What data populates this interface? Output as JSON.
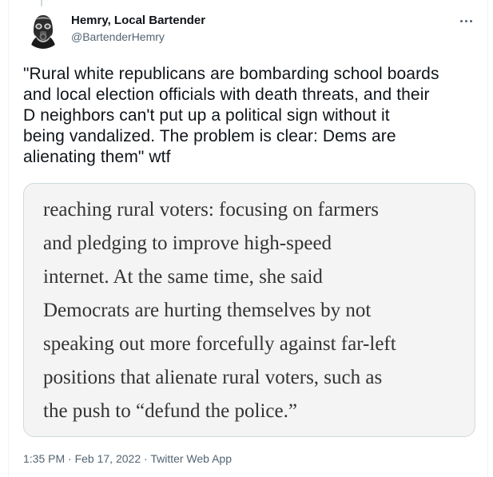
{
  "tweet": {
    "author": {
      "display_name": "Hemry, Local Bartender",
      "handle": "@BartenderHemry"
    },
    "text": "\"Rural white republicans are bombarding school boards\nand local election officials with death threats, and their\nD neighbors can't put up a political sign without it\nbeing vandalized. The problem is clear: Dems are\nalienating them\" wtf",
    "media": {
      "cut_text": "",
      "body": "reaching rural voters: focusing on farmers\nand pledging to improve high-speed\ninternet. At the same time, she said\nDemocrats are hurting themselves by not\nspeaking out more forcefully against far-left\npositions that alienate rural voters, such as\nthe push to “defund the police.”"
    },
    "meta": {
      "time": "1:35 PM",
      "separator": "·",
      "date": "Feb 17, 2022",
      "source": "Twitter Web App"
    }
  },
  "icons": {
    "avatar": "gas-mask-avatar",
    "more": "more-horizontal-icon"
  },
  "colors": {
    "text_primary": "#0f1419",
    "text_secondary": "#536471",
    "border": "#cfd9de",
    "media_background": "#f4f4f4"
  }
}
